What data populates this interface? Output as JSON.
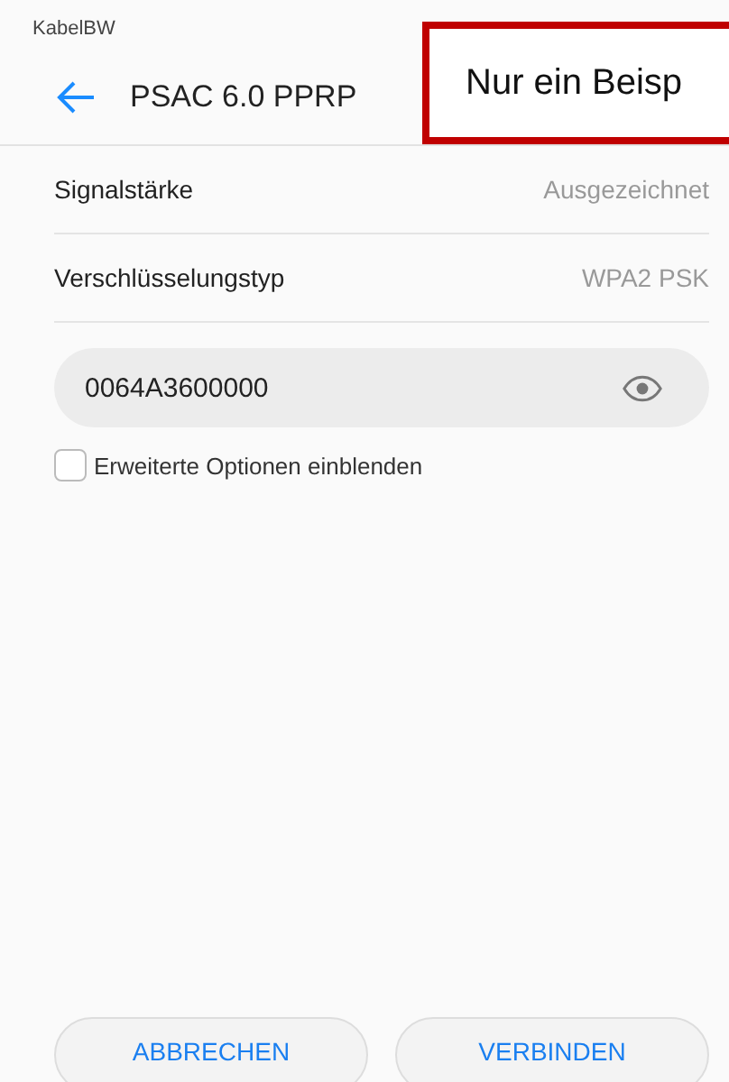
{
  "status_bar": {
    "carrier": "KabelBW"
  },
  "header": {
    "title": "PSAC 6.0 PPRP"
  },
  "annotation": {
    "text": "Nur ein Beisp"
  },
  "rows": [
    {
      "label": "Signalstärke",
      "value": "Ausgezeichnet"
    },
    {
      "label": "Verschlüsselungstyp",
      "value": "WPA2 PSK"
    }
  ],
  "password": {
    "value": "0064A3600000"
  },
  "advanced": {
    "label": "Erweiterte Optionen einblenden",
    "checked": false
  },
  "buttons": [
    "ABBRECHEN",
    "VERBINDEN"
  ]
}
